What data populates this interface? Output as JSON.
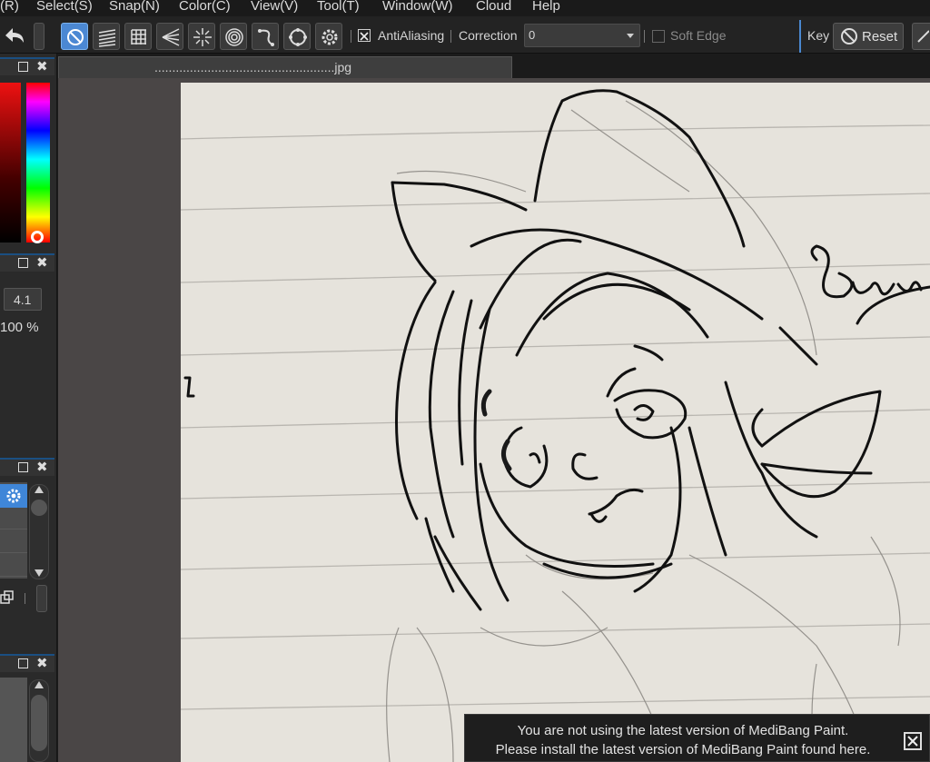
{
  "menu": {
    "items": [
      "(R)",
      "Select(S)",
      "Snap(N)",
      "Color(C)",
      "View(V)",
      "Tool(T)",
      "Window(W)",
      "Cloud",
      "Help"
    ]
  },
  "toolbar": {
    "antialiasing_label": "AntiAliasing",
    "antialiasing_checked": true,
    "correction_label": "Correction",
    "correction_value": "0",
    "soft_edge_label": "Soft Edge",
    "soft_edge_checked": false,
    "key_label": "Key",
    "reset_label": "Reset",
    "snap_tools": [
      "snap-off-icon",
      "parallel-snap-icon",
      "grid-snap-icon",
      "perspective-snap-icon",
      "radial-snap-icon",
      "concentric-snap-icon",
      "curve-snap-icon",
      "circle-snap-icon",
      "snap-settings-gear-icon"
    ],
    "active_tool_color": "#4b88d3"
  },
  "left_panel": {
    "brush_size": "4.1",
    "opacity": "100 %"
  },
  "document": {
    "tab_title": "...................................................jpg"
  },
  "notice": {
    "line1": "You are not using the latest version of MediBang Paint.",
    "line2": "Please install the latest version of MediBang Paint found here."
  }
}
